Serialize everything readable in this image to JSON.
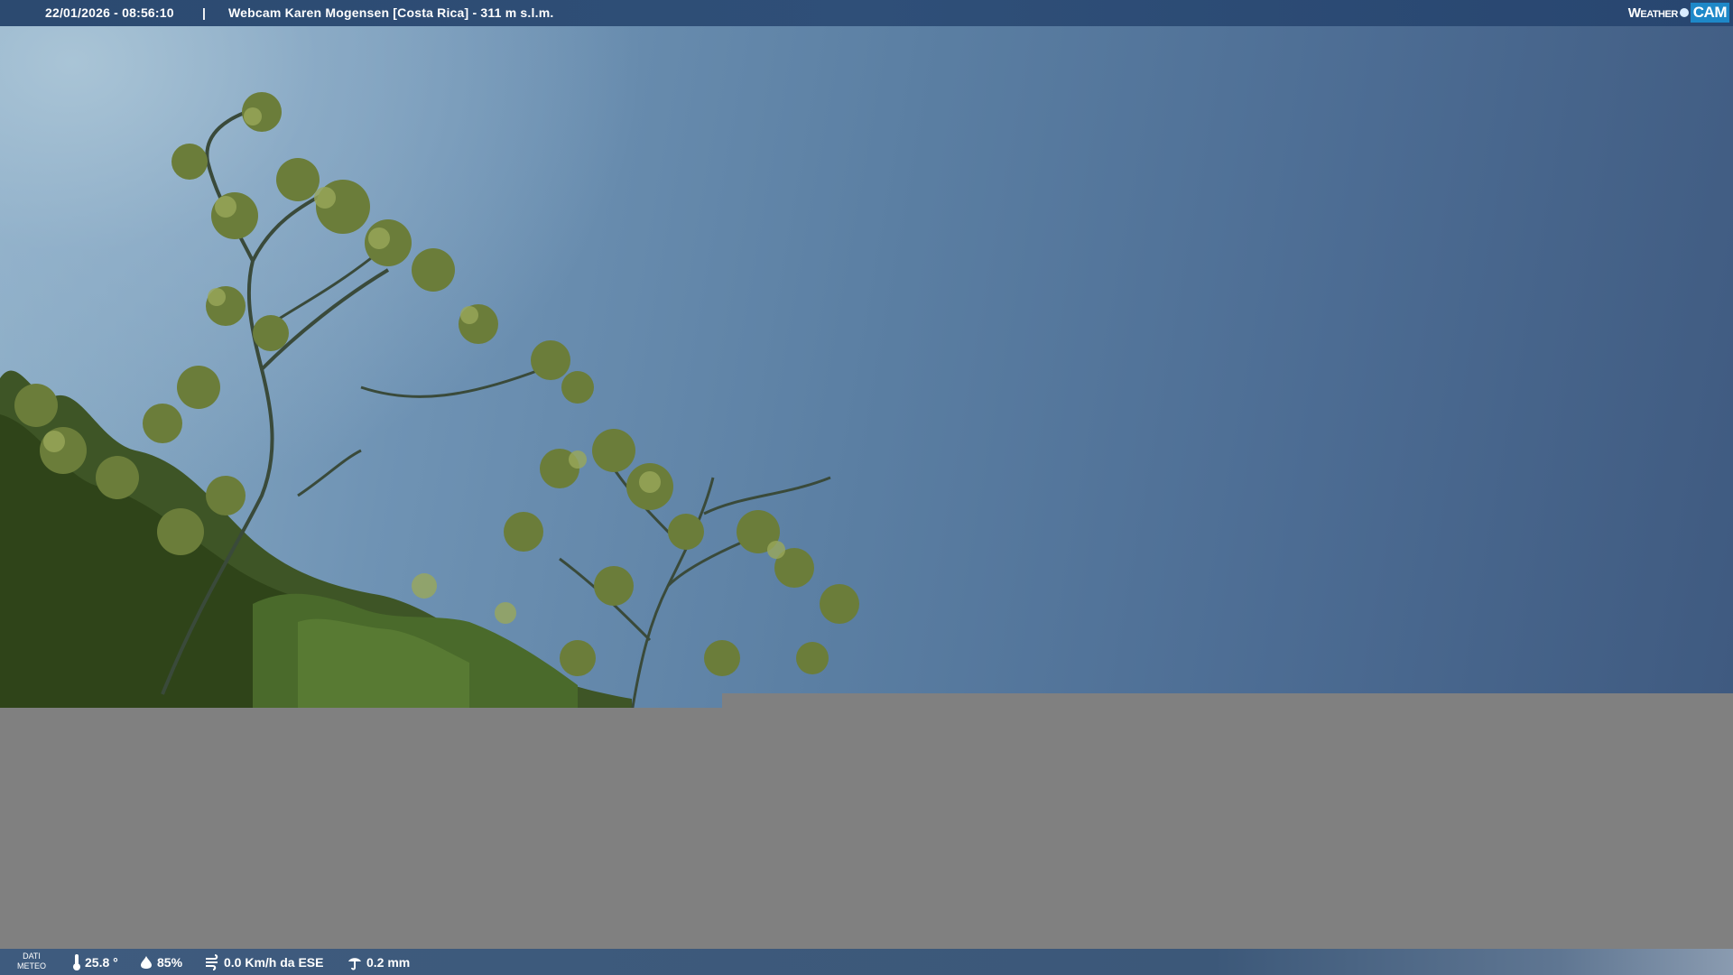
{
  "top_bar": {
    "datetime": "22/01/2026 - 08:56:10",
    "separator": "|",
    "location": "Webcam Karen Mogensen [Costa Rica]  - 311 m s.l.m."
  },
  "brand": {
    "word1": "Weather",
    "word2": "CAM"
  },
  "bottom_bar": {
    "label_line1": "DATI",
    "label_line2": "METEO",
    "temperature": "25.8 °",
    "humidity": "85%",
    "wind": "0.0 Km/h da ESE",
    "rain": "0.2 mm"
  },
  "icons": {
    "temperature": "thermometer-icon",
    "humidity": "humidity-drop-icon",
    "wind": "wind-icon",
    "rain": "rain-gauge-icon",
    "brand_dot": "camera-lens-dot-icon"
  },
  "colors": {
    "bar_background": "#2f4f78",
    "sky_light": "#a9c4d6",
    "sky_dark": "#3f5a80",
    "gray_area": "#808080",
    "brand_accent": "#1e88c8"
  }
}
